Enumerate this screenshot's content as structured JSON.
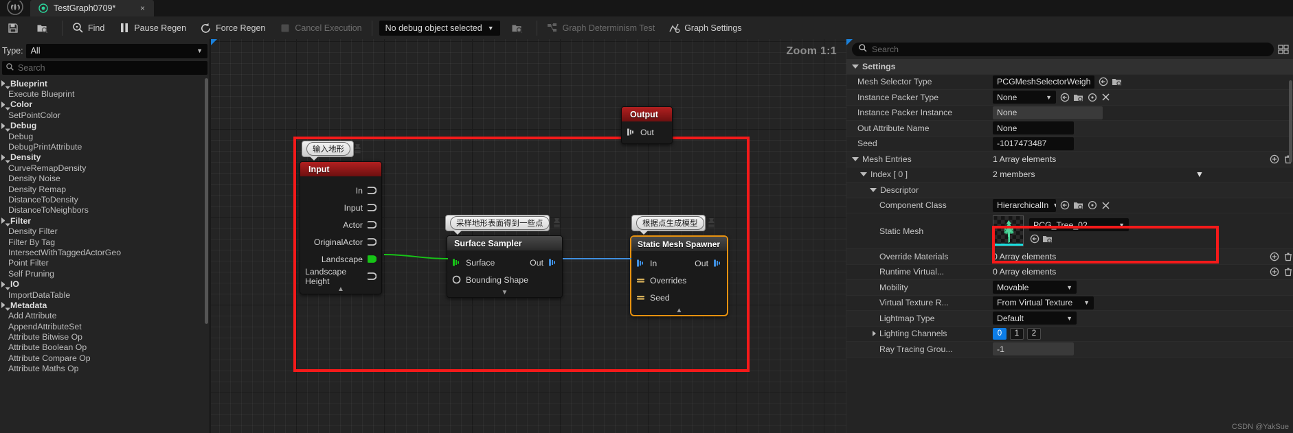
{
  "tab": {
    "title": "TestGraph0709*",
    "close_label": "×",
    "icon": "pcg-graph-icon"
  },
  "toolbar": {
    "save_label": "",
    "browse_label": "",
    "find_label": "Find",
    "pause_regen_label": "Pause Regen",
    "force_regen_label": "Force Regen",
    "cancel_execution_label": "Cancel Execution",
    "debug_object_label": "No debug object selected",
    "debug_browse_label": "",
    "graph_determinism_label": "Graph Determinism Test",
    "graph_settings_label": "Graph Settings"
  },
  "palette": {
    "type_label": "Type:",
    "type_value": "All",
    "search_placeholder": "Search",
    "groups": [
      {
        "name": "Blueprint",
        "items": [
          "Execute Blueprint"
        ]
      },
      {
        "name": "Color",
        "items": [
          "SetPointColor"
        ]
      },
      {
        "name": "Debug",
        "items": [
          "Debug",
          "DebugPrintAttribute"
        ]
      },
      {
        "name": "Density",
        "items": [
          "CurveRemapDensity",
          "Density Noise",
          "Density Remap",
          "DistanceToDensity",
          "DistanceToNeighbors"
        ]
      },
      {
        "name": "Filter",
        "items": [
          "Density Filter",
          "Filter By Tag",
          "IntersectWithTaggedActorGeo",
          "Point Filter",
          "Self Pruning"
        ]
      },
      {
        "name": "IO",
        "items": [
          "ImportDataTable"
        ]
      },
      {
        "name": "Metadata",
        "items": [
          "Add Attribute",
          "AppendAttributeSet",
          "Attribute Bitwise Op",
          "Attribute Boolean Op",
          "Attribute Compare Op",
          "Attribute Maths Op"
        ]
      }
    ]
  },
  "graph": {
    "zoom_label": "Zoom 1:1",
    "nodes": {
      "output": {
        "title": "Output",
        "ports": [
          {
            "label": "Out"
          }
        ]
      },
      "input": {
        "title": "Input",
        "bubble": "输入地形",
        "ports": [
          {
            "label": "In"
          },
          {
            "label": "Input"
          },
          {
            "label": "Actor"
          },
          {
            "label": "OriginalActor"
          },
          {
            "label": "Landscape"
          },
          {
            "label": "Landscape Height"
          }
        ]
      },
      "surface_sampler": {
        "title": "Surface Sampler",
        "bubble": "采样地形表面得到一些点",
        "in_label": "Surface",
        "out_label": "Out",
        "extra_label": "Bounding Shape"
      },
      "static_mesh_spawner": {
        "title": "Static Mesh Spawner",
        "bubble": "根据点生成模型",
        "in_label": "In",
        "out_label": "Out",
        "rows": [
          "Overrides",
          "Seed"
        ]
      }
    }
  },
  "details": {
    "search_placeholder": "Search",
    "section_title": "Settings",
    "rows": [
      {
        "name": "Mesh Selector Type",
        "value": "PCGMeshSelectorWeigh",
        "kind": "combo"
      },
      {
        "name": "Instance Packer Type",
        "value": "None",
        "kind": "combo"
      },
      {
        "name": "Instance Packer Instance",
        "value": "None",
        "kind": "grey"
      },
      {
        "name": "Out Attribute Name",
        "value": "None",
        "kind": "field"
      },
      {
        "name": "Seed",
        "value": "-1017473487",
        "kind": "field"
      }
    ],
    "mesh_entries": {
      "name": "Mesh Entries",
      "value": "1 Array elements"
    },
    "index": {
      "name": "Index [ 0 ]",
      "value": "2 members"
    },
    "descriptor": {
      "name": "Descriptor",
      "value": ""
    },
    "component_class": {
      "name": "Component Class",
      "value": "HierarchicalIn"
    },
    "static_mesh": {
      "name": "Static Mesh",
      "value": "PCG_Tree_02"
    },
    "tail_rows": [
      {
        "name": "Override Materials",
        "value": "0 Array elements",
        "kind": "plain"
      },
      {
        "name": "Runtime Virtual...",
        "value": "0 Array elements",
        "kind": "plain"
      },
      {
        "name": "Mobility",
        "value": "Movable",
        "kind": "combo"
      },
      {
        "name": "Virtual Texture R...",
        "value": "From Virtual Texture",
        "kind": "combo"
      },
      {
        "name": "Lightmap Type",
        "value": "Default",
        "kind": "combo"
      },
      {
        "name": "Lighting Channels",
        "value": "",
        "kind": "channels"
      },
      {
        "name": "Ray Tracing Grou...",
        "value": "-1",
        "kind": "grey"
      }
    ],
    "lighting_channels": [
      "0",
      "1",
      "2"
    ],
    "watermark": "CSDN @YakSue"
  },
  "colors": {
    "accent_blue": "#1a80da",
    "selection_red": "#f51a1a",
    "node_orange": "#e8920f",
    "input_red": "#8a1313",
    "output_red": "#8a1313",
    "green_pin": "#17c417"
  }
}
